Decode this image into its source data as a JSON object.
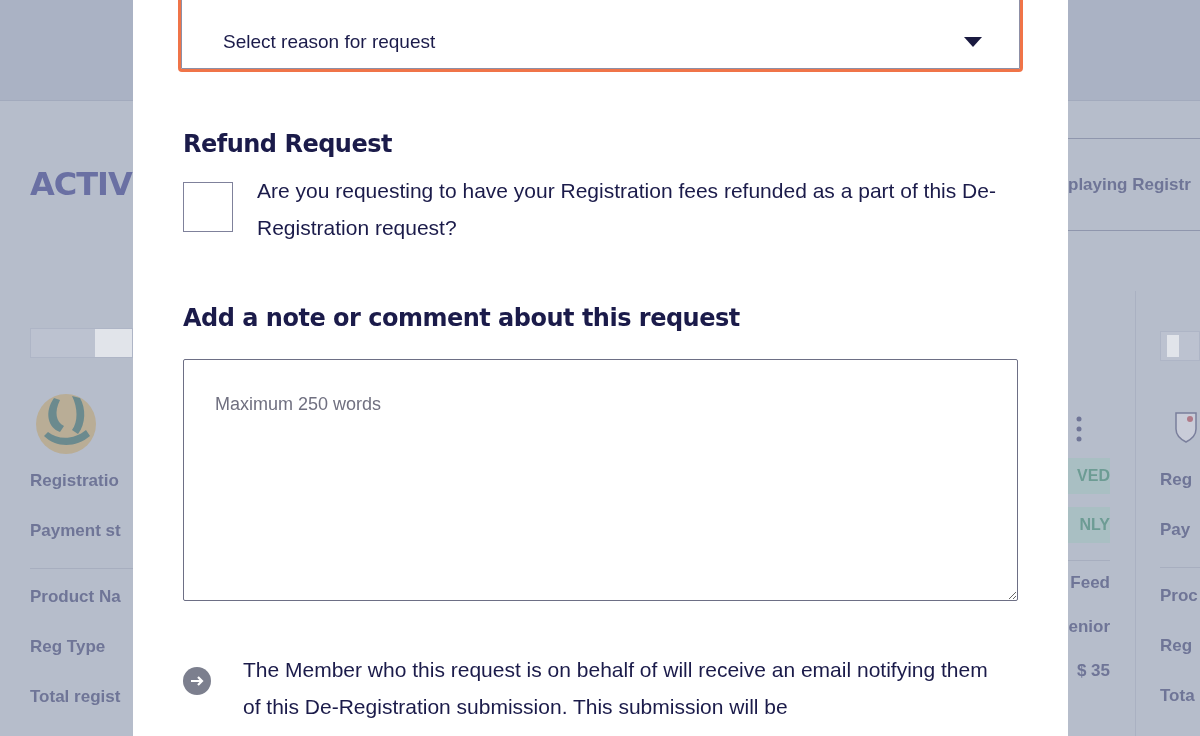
{
  "background": {
    "left_card": {
      "heading": "ACTIV",
      "labels": [
        "Registratio",
        "Payment st",
        "Product Na",
        "Reg Type",
        "Total regist"
      ]
    },
    "right_side": {
      "tab_text": "playing Registr",
      "badges": [
        "VED",
        "NLY"
      ],
      "values": [
        "Feed",
        "enior",
        "$ 35"
      ],
      "next_card_labels": [
        "Reg",
        "Pay",
        "Proc",
        "Reg",
        "Tota"
      ]
    }
  },
  "modal": {
    "reason_select": {
      "placeholder": "Select reason for request",
      "focused": true
    },
    "refund": {
      "heading": "Refund Request",
      "checkbox": {
        "label": "Are you requesting to have your Registration fees refunded as a part of this De-Registration request?",
        "checked": false
      }
    },
    "note": {
      "heading": "Add a note or comment about this request",
      "placeholder": "Maximum 250 words"
    },
    "info": {
      "text": "The Member who this request is on behalf of will receive an email notifying them of this De-Registration submission. This submission will be"
    }
  }
}
